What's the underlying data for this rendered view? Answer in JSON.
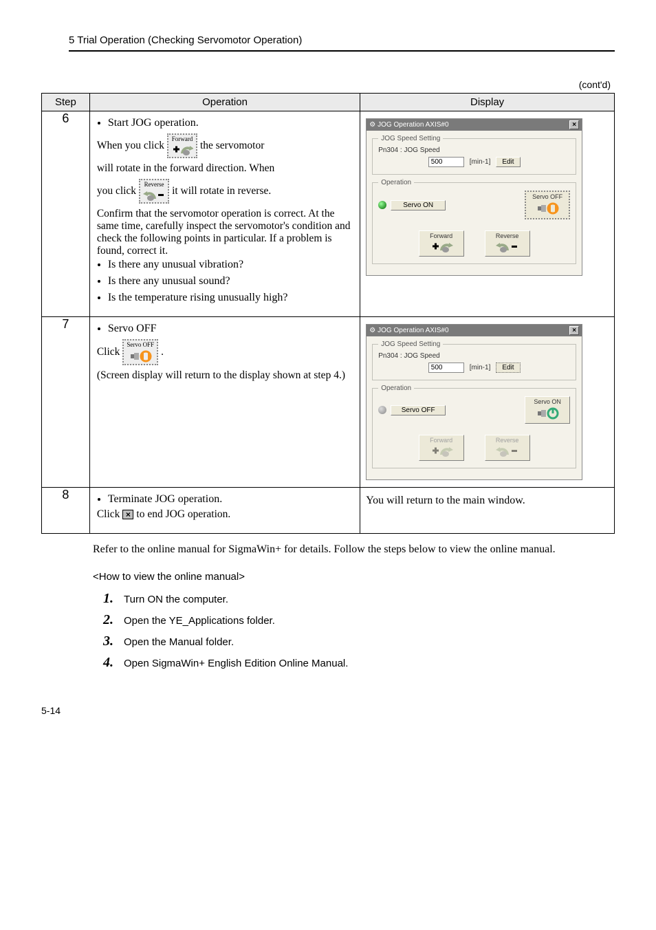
{
  "header": {
    "chapter": "5  Trial Operation (Checking Servomotor Operation)"
  },
  "contd": "(cont'd)",
  "table": {
    "headers": {
      "step": "Step",
      "operation": "Operation",
      "display": "Display"
    },
    "row6": {
      "step": "6",
      "bullet1": "Start JOG operation.",
      "line1a": "When you click",
      "fwd_label": "Forward",
      "line1b": "the servomotor",
      "line2": "will rotate in the forward direction. When",
      "line3a": "you click",
      "rev_label": "Reverse",
      "line3b": "it will rotate in reverse.",
      "para": "Confirm that the servomotor operation is correct. At the same time, carefully inspect the servomotor's condition and check the following points in particular. If a problem is found, correct it.",
      "sub": [
        "Is there any unusual vibration?",
        "Is there any unusual sound?",
        "Is the temperature rising unusually high?"
      ]
    },
    "row7": {
      "step": "7",
      "bullet1": "Servo OFF",
      "clicktext": "Click",
      "servo_off_label": "Servo OFF",
      "dot": ".",
      "after": "(Screen display will return to the display shown at step 4.)"
    },
    "row8": {
      "step": "8",
      "bullet1": "Terminate JOG operation.",
      "line_a": "Click",
      "line_b": "to end JOG operation.",
      "display": "You will return to the main window."
    }
  },
  "win_on": {
    "title": "JOG Operation AXIS#0",
    "group_speed": "JOG Speed Setting",
    "pn": "Pn304 : JOG Speed",
    "val": "500",
    "unit": "[min-1]",
    "edit": "Edit",
    "group_op": "Operation",
    "status": "Servo ON",
    "servo_off": "Servo OFF",
    "fwd": "Forward",
    "rev": "Reverse"
  },
  "win_off": {
    "title": "JOG Operation AXIS#0",
    "group_speed": "JOG Speed Setting",
    "pn": "Pn304 : JOG Speed",
    "val": "500",
    "unit": "[min-1]",
    "edit": "Edit",
    "group_op": "Operation",
    "status": "Servo OFF",
    "servo_on": "Servo ON",
    "fwd": "Forward",
    "rev": "Reverse"
  },
  "footer": {
    "para": "Refer to the online manual for SigmaWin+ for details. Follow the steps below to view the online manual.",
    "howto": "<How to view the online manual>",
    "steps": [
      "Turn ON the computer.",
      "Open the YE_Applications folder.",
      "Open the Manual folder.",
      "Open SigmaWin+ English Edition Online Manual."
    ]
  },
  "pagenum": "5-14"
}
